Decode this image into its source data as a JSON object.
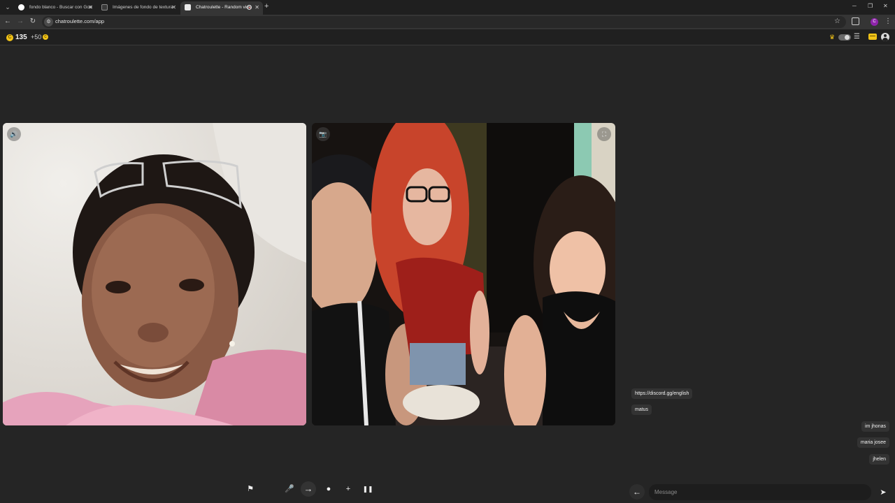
{
  "browser": {
    "tabs": [
      {
        "title": "fondo blanco - Buscar con Goo",
        "favicon_color": "#ffffff"
      },
      {
        "title": "Imágenes de fondo de textura",
        "favicon_color": "#3a3a3a"
      },
      {
        "title": "Chatroulette - Random vide",
        "favicon_color": "#e8e8e8"
      }
    ],
    "close_glyph": "✕",
    "new_tab_glyph": "+",
    "url": "chatroulette.com/app",
    "profile_initial": "C"
  },
  "header": {
    "coin_glyph": "C",
    "coin_count": "135",
    "coin_bonus": "+50"
  },
  "chat": {
    "incoming": [
      "https://discord.gg/english",
      "matus"
    ],
    "outgoing": [
      "im jhonas",
      "maria josee",
      "jhelen"
    ],
    "input_placeholder": "Message"
  },
  "icons": {
    "volume": "🔊",
    "camera": "📷",
    "fullscreen": "⛶",
    "flag": "⚑",
    "mic": "🎤",
    "next": "→",
    "chat": "●",
    "add_friend": "+",
    "pause": "❚❚",
    "back": "←",
    "send": "➤"
  },
  "colors": {
    "background": "#252525",
    "coin": "#f2c418",
    "bubble": "#333333"
  }
}
